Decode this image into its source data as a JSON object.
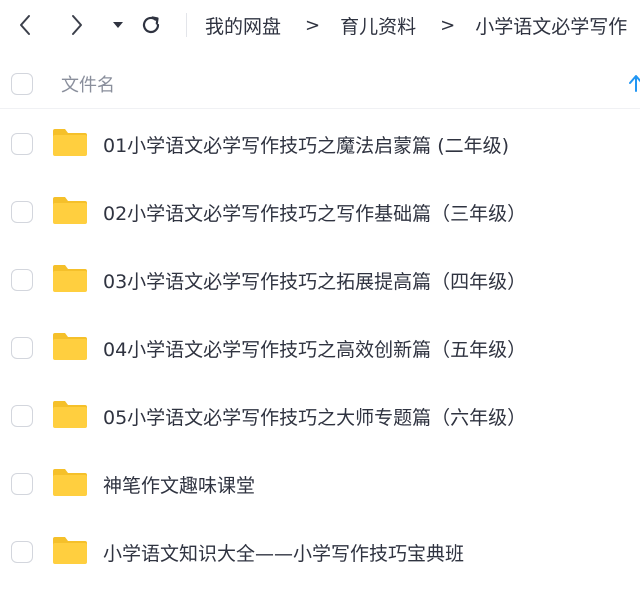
{
  "toolbar": {
    "back_icon": "chevron-left-icon",
    "forward_icon": "chevron-right-icon",
    "history_icon": "caret-down-icon",
    "refresh_icon": "refresh-icon",
    "breadcrumb": [
      "我的网盘",
      "育儿资料",
      "小学语文必学写作"
    ],
    "breadcrumb_sep": ">"
  },
  "list_header": {
    "name_column": "文件名",
    "sort_icon": "arrow-up-icon"
  },
  "files": [
    {
      "name": "01小学语文必学写作技巧之魔法启蒙篇 (二年级)",
      "icon": "folder-icon"
    },
    {
      "name": "02小学语文必学写作技巧之写作基础篇（三年级）",
      "icon": "folder-icon"
    },
    {
      "name": "03小学语文必学写作技巧之拓展提高篇（四年级）",
      "icon": "folder-icon"
    },
    {
      "name": "04小学语文必学写作技巧之高效创新篇（五年级）",
      "icon": "folder-icon"
    },
    {
      "name": "05小学语文必学写作技巧之大师专题篇（六年级）",
      "icon": "folder-icon"
    },
    {
      "name": "神笔作文趣味课堂",
      "icon": "folder-icon"
    },
    {
      "name": "小学语文知识大全——小学写作技巧宝典班",
      "icon": "folder-icon"
    }
  ],
  "colors": {
    "folder": "#ffcf3f",
    "folder_tab": "#f5c02a",
    "accent": "#2196f3"
  }
}
